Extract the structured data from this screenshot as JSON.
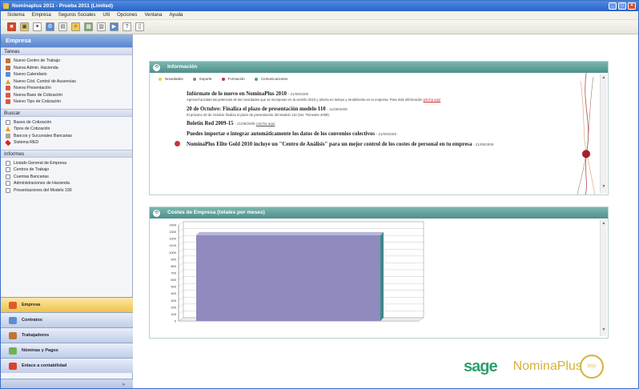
{
  "window": {
    "title": "Nominaplus 2011 - Prueba 2011 (Limited)",
    "buttons": [
      "_",
      "□",
      "×"
    ]
  },
  "menu": [
    "Sistema",
    "Empresa",
    "Seguros Sociales",
    "Util",
    "Opciones",
    "Ventana",
    "Ayuda"
  ],
  "toolbar": {
    "icons": [
      "exit-icon",
      "company-icon",
      "tools-icon",
      "settings-icon",
      "print-icon",
      "magic-icon",
      "folder-icon",
      "calc-icon",
      "export-icon",
      "help-icon",
      "document-icon"
    ]
  },
  "sidebar": {
    "header": "Empresa",
    "sections": [
      {
        "title": "Tareas",
        "items": [
          {
            "label": "Nuevo Centro de Trabajo",
            "icon": "person-icon"
          },
          {
            "label": "Nueva Admin. Hacienda",
            "icon": "person-icon"
          },
          {
            "label": "Nuevo Calendario",
            "icon": "calendar-icon"
          },
          {
            "label": "Nuevo Cód. Control de Ausencias",
            "icon": "warning-icon"
          },
          {
            "label": "Nueva Presentación",
            "icon": "tax-icon"
          },
          {
            "label": "Nueva Base de Cotización",
            "icon": "tax-icon"
          },
          {
            "label": "Nuevo Tipo de Cotización",
            "icon": "tax-icon"
          }
        ]
      },
      {
        "title": "Buscar",
        "items": [
          {
            "label": "Bases de Cotización",
            "icon": "document-icon"
          },
          {
            "label": "Tipos de Cotización",
            "icon": "warning-icon"
          },
          {
            "label": "Bancos y Sucursales Bancarias",
            "icon": "bank-icon"
          },
          {
            "label": "Sistema RED",
            "icon": "red-icon"
          }
        ]
      },
      {
        "title": "Informes",
        "items": [
          {
            "label": "Listado General de Empresa",
            "icon": "report-icon"
          },
          {
            "label": "Centros de Trabajo",
            "icon": "report-icon"
          },
          {
            "label": "Cuentas Bancarias",
            "icon": "report-icon"
          },
          {
            "label": "Administraciones de Hacienda",
            "icon": "report-icon"
          },
          {
            "label": "Presentaciones del Modelo 190",
            "icon": "report-icon"
          }
        ]
      }
    ],
    "nav_buttons": [
      {
        "label": "Empresa",
        "active": true,
        "color": "#e05a2b"
      },
      {
        "label": "Contratos",
        "active": false,
        "color": "#5a8ed0"
      },
      {
        "label": "Trabajadores",
        "active": false,
        "color": "#c0743b"
      },
      {
        "label": "Nóminas y Pagos",
        "active": false,
        "color": "#6fb05a"
      },
      {
        "label": "Enlace a contabilidad",
        "active": false,
        "color": "#d9432e"
      }
    ],
    "footer": "»"
  },
  "info_panel": {
    "title": "Información",
    "legend": [
      {
        "label": "Novedades",
        "color": "#e6cf3a"
      },
      {
        "label": "Soporte",
        "color": "#8a8a8a"
      },
      {
        "label": "Formación",
        "color": "#c8323f"
      },
      {
        "label": "Comunicaciones",
        "color": "#4f9f8a"
      }
    ],
    "news": [
      {
        "title": "Infórmate de lo nuevo en NominaPlus 2010",
        "date": "- 21/09/2009",
        "desc": "Aprovecha todas las potencias de las novedades que se incorporan en la versión 2010 y ahorra en tiempo y rendimiento en tu empresa. Para más información",
        "link": "pincha aquí"
      },
      {
        "title": "20 de Octubre: Finaliza el plazo de presentación modelo 110",
        "date": "- 21/09/2009",
        "desc": "El próximo 20 de Octubre finaliza el plazo de presentación del Modelo 110 (3er. Trimestre 2009).",
        "link": ""
      },
      {
        "title": "Boletín Red 2009-15",
        "date": "- 21/09/2009",
        "desc": "",
        "link": "pincha aquí"
      },
      {
        "title": "Puedes importar e integrar automáticamente los datos de los convenios colectivos",
        "date": "- 21/09/2009",
        "desc": "",
        "link": ""
      },
      {
        "title": "NominaPlus Elite Gold 2010 incluye un \"Centro de Análisis\" para un mejor control de los costes de personal en tu empresa",
        "date": "- 21/09/2009",
        "desc": "",
        "link": ""
      }
    ]
  },
  "chart_panel": {
    "title": "Costes de Empresa (totales por meses)"
  },
  "chart_data": {
    "type": "bar",
    "categories": [
      ""
    ],
    "values": [
      1250
    ],
    "title": "",
    "xlabel": "",
    "ylabel": "",
    "ylim": [
      0,
      1400
    ],
    "yticks": [
      0,
      100,
      200,
      300,
      400,
      500,
      600,
      700,
      800,
      900,
      1000,
      1100,
      1200,
      1300,
      1400
    ],
    "bar_color": "#8f8bbe",
    "grid": true
  },
  "branding": {
    "sage": "sage",
    "product": "NominaPlus",
    "ring_text": "2010"
  }
}
